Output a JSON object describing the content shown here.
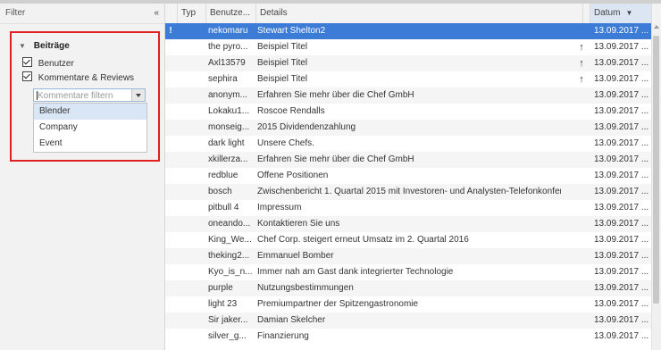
{
  "filter": {
    "title": "Filter",
    "collapse_glyph": "«",
    "section": {
      "title": "Beiträge",
      "checkboxes": [
        {
          "label": "Benutzer",
          "checked": true
        },
        {
          "label": "Kommentare & Reviews",
          "checked": true
        }
      ],
      "combo": {
        "placeholder": "Kommentare filtern",
        "options": [
          "Blender",
          "Company",
          "Event"
        ],
        "highlighted": "Blender"
      }
    }
  },
  "table": {
    "columns": {
      "type": "Typ",
      "user": "Benutze...",
      "details": "Details",
      "date": "Datum"
    },
    "sort_glyph": "▼",
    "rows": [
      {
        "flag": "!",
        "icon": "user-icon",
        "user": "nekomaru",
        "details": "Stewart Shelton2",
        "arrow": "",
        "date": "13.09.2017 ..."
      },
      {
        "flag": "",
        "icon": "comment-review-icon",
        "user": "the pyro...",
        "details": "Beispiel Titel",
        "arrow": "↑",
        "date": "13.09.2017 ..."
      },
      {
        "flag": "",
        "icon": "comment-review-icon",
        "user": "Axl13579",
        "details": "Beispiel Titel",
        "arrow": "↑",
        "date": "13.09.2017 ..."
      },
      {
        "flag": "",
        "icon": "comment-review-icon",
        "user": "sephira",
        "details": "Beispiel Titel",
        "arrow": "↑",
        "date": "13.09.2017 ..."
      },
      {
        "flag": "",
        "icon": "comment-icon",
        "user": "anonym...",
        "details": "Erfahren Sie mehr über die Chef GmbH",
        "arrow": "",
        "date": "13.09.2017 ..."
      },
      {
        "flag": "",
        "icon": "user-icon",
        "user": "Lokaku1...",
        "details": "Roscoe Rendalls",
        "arrow": "",
        "date": "13.09.2017 ..."
      },
      {
        "flag": "",
        "icon": "comment-review-icon",
        "user": "monseig...",
        "details": "2015 Dividendenzahlung",
        "arrow": "",
        "date": "13.09.2017 ..."
      },
      {
        "flag": "",
        "icon": "comment-review-icon",
        "user": "dark light",
        "details": "Unsere Chefs.",
        "arrow": "",
        "date": "13.09.2017 ..."
      },
      {
        "flag": "",
        "icon": "comment-review-icon",
        "user": "xkillerza...",
        "details": "Erfahren Sie mehr über die Chef GmbH",
        "arrow": "",
        "date": "13.09.2017 ..."
      },
      {
        "flag": "",
        "icon": "comment-review-icon",
        "user": "redblue",
        "details": "Offene Positionen",
        "arrow": "",
        "date": "13.09.2017 ..."
      },
      {
        "flag": "",
        "icon": "comment-review-icon",
        "user": "bosch",
        "details": "Zwischenbericht 1. Quartal 2015 mit Investoren- und Analysten-Telefonkonfer...",
        "arrow": "",
        "date": "13.09.2017 ..."
      },
      {
        "flag": "",
        "icon": "comment-review-icon",
        "user": "pitbull 4",
        "details": "Impressum",
        "arrow": "",
        "date": "13.09.2017 ..."
      },
      {
        "flag": "",
        "icon": "comment-review-icon",
        "user": "oneando...",
        "details": "Kontaktieren Sie uns",
        "arrow": "",
        "date": "13.09.2017 ..."
      },
      {
        "flag": "",
        "icon": "comment-review-icon",
        "user": "King_We...",
        "details": "Chef Corp. steigert erneut Umsatz im 2. Quartal 2016",
        "arrow": "",
        "date": "13.09.2017 ..."
      },
      {
        "flag": "",
        "icon": "user-icon",
        "user": "theking2...",
        "details": "Emmanuel Bomber",
        "arrow": "",
        "date": "13.09.2017 ..."
      },
      {
        "flag": "",
        "icon": "comment-review-icon",
        "user": "Kyo_is_n...",
        "details": "Immer nah am Gast dank integrierter Technologie",
        "arrow": "",
        "date": "13.09.2017 ..."
      },
      {
        "flag": "",
        "icon": "comment-review-icon",
        "user": "purple",
        "details": "Nutzungsbestimmungen",
        "arrow": "",
        "date": "13.09.2017 ..."
      },
      {
        "flag": "",
        "icon": "comment-review-icon",
        "user": "light 23",
        "details": "Premiumpartner der Spitzengastronomie",
        "arrow": "",
        "date": "13.09.2017 ..."
      },
      {
        "flag": "",
        "icon": "user-icon",
        "user": "Sir jaker...",
        "details": "Damian Skelcher",
        "arrow": "",
        "date": "13.09.2017 ..."
      },
      {
        "flag": "",
        "icon": "comment-review-icon",
        "user": "silver_g...",
        "details": "Finanzierung",
        "arrow": "",
        "date": "13.09.2017 ..."
      }
    ]
  },
  "colors": {
    "selected_row": "#3c7bd6",
    "highlight_box": "#e02020",
    "icon": "#4a4a4a"
  }
}
